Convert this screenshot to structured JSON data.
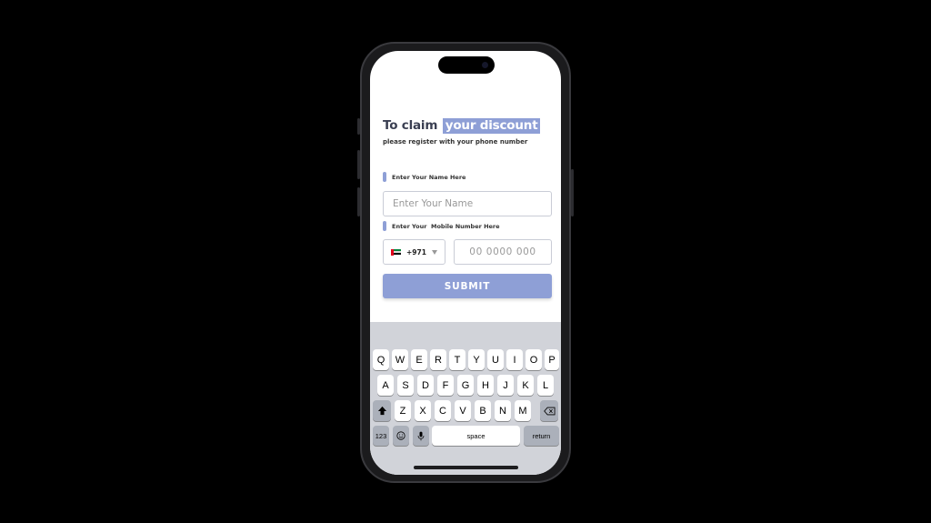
{
  "form": {
    "headline_part1": "To claim",
    "headline_highlight": "your discount",
    "subheadline": "please register with your phone number",
    "name_label": "Enter Your Name Here",
    "name_placeholder": "Enter Your Name",
    "mobile_label": "Enter Your  Mobile Number Here",
    "country_code": "+971",
    "phone_placeholder": "00 0000 000",
    "submit_label": "SUBMIT"
  },
  "keyboard": {
    "row1": [
      "Q",
      "W",
      "E",
      "R",
      "T",
      "Y",
      "U",
      "I",
      "O",
      "P"
    ],
    "row2": [
      "A",
      "S",
      "D",
      "F",
      "G",
      "H",
      "J",
      "K",
      "L"
    ],
    "row3": [
      "Z",
      "X",
      "C",
      "V",
      "B",
      "N",
      "M"
    ],
    "numbers_key": "123",
    "space_key": "space",
    "return_key": "return"
  },
  "colors": {
    "accent": "#8e9fd6",
    "keyboard_bg": "#d1d3d9"
  }
}
